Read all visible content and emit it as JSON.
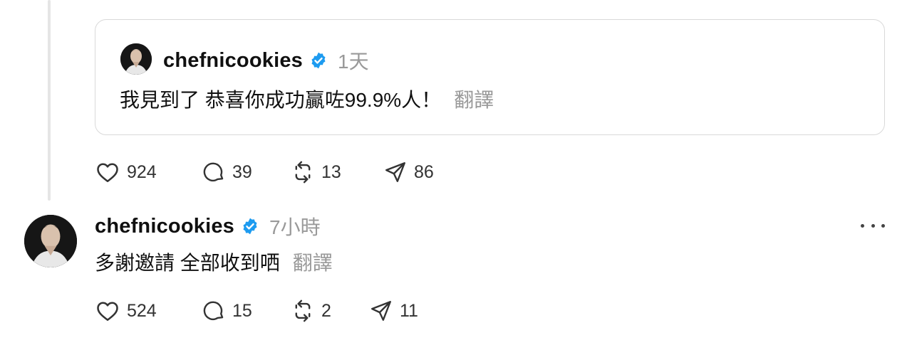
{
  "quoted_post": {
    "username": "chefnicookies",
    "verified_icon": "verified-badge-icon",
    "time": "1天",
    "text": "我見到了 恭喜你成功贏咗99.9%人！",
    "translate_label": "翻譯"
  },
  "parent_actions": {
    "likes": "924",
    "comments": "39",
    "reposts": "13",
    "shares": "86"
  },
  "reply": {
    "username": "chefnicookies",
    "verified_icon": "verified-badge-icon",
    "time": "7小時",
    "text": "多謝邀請 全部收到哂",
    "translate_label": "翻譯",
    "more_icon": "more-options-icon",
    "actions": {
      "likes": "524",
      "comments": "15",
      "reposts": "2",
      "shares": "11"
    }
  },
  "colors": {
    "verified": "#1D9BF0",
    "muted_text": "#999999",
    "border": "#D9D9D9",
    "thread_line": "#E5E5E5"
  }
}
